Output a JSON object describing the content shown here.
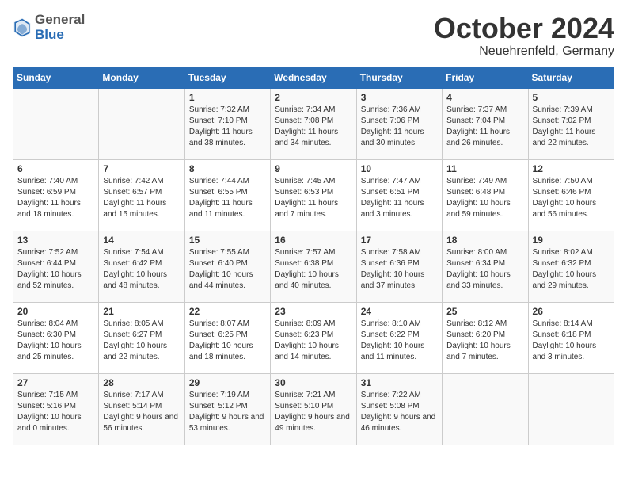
{
  "header": {
    "logo_general": "General",
    "logo_blue": "Blue",
    "month_title": "October 2024",
    "location": "Neuehrenfeld, Germany"
  },
  "days_of_week": [
    "Sunday",
    "Monday",
    "Tuesday",
    "Wednesday",
    "Thursday",
    "Friday",
    "Saturday"
  ],
  "weeks": [
    [
      {
        "day": "",
        "info": ""
      },
      {
        "day": "",
        "info": ""
      },
      {
        "day": "1",
        "info": "Sunrise: 7:32 AM\nSunset: 7:10 PM\nDaylight: 11 hours and 38 minutes."
      },
      {
        "day": "2",
        "info": "Sunrise: 7:34 AM\nSunset: 7:08 PM\nDaylight: 11 hours and 34 minutes."
      },
      {
        "day": "3",
        "info": "Sunrise: 7:36 AM\nSunset: 7:06 PM\nDaylight: 11 hours and 30 minutes."
      },
      {
        "day": "4",
        "info": "Sunrise: 7:37 AM\nSunset: 7:04 PM\nDaylight: 11 hours and 26 minutes."
      },
      {
        "day": "5",
        "info": "Sunrise: 7:39 AM\nSunset: 7:02 PM\nDaylight: 11 hours and 22 minutes."
      }
    ],
    [
      {
        "day": "6",
        "info": "Sunrise: 7:40 AM\nSunset: 6:59 PM\nDaylight: 11 hours and 18 minutes."
      },
      {
        "day": "7",
        "info": "Sunrise: 7:42 AM\nSunset: 6:57 PM\nDaylight: 11 hours and 15 minutes."
      },
      {
        "day": "8",
        "info": "Sunrise: 7:44 AM\nSunset: 6:55 PM\nDaylight: 11 hours and 11 minutes."
      },
      {
        "day": "9",
        "info": "Sunrise: 7:45 AM\nSunset: 6:53 PM\nDaylight: 11 hours and 7 minutes."
      },
      {
        "day": "10",
        "info": "Sunrise: 7:47 AM\nSunset: 6:51 PM\nDaylight: 11 hours and 3 minutes."
      },
      {
        "day": "11",
        "info": "Sunrise: 7:49 AM\nSunset: 6:48 PM\nDaylight: 10 hours and 59 minutes."
      },
      {
        "day": "12",
        "info": "Sunrise: 7:50 AM\nSunset: 6:46 PM\nDaylight: 10 hours and 56 minutes."
      }
    ],
    [
      {
        "day": "13",
        "info": "Sunrise: 7:52 AM\nSunset: 6:44 PM\nDaylight: 10 hours and 52 minutes."
      },
      {
        "day": "14",
        "info": "Sunrise: 7:54 AM\nSunset: 6:42 PM\nDaylight: 10 hours and 48 minutes."
      },
      {
        "day": "15",
        "info": "Sunrise: 7:55 AM\nSunset: 6:40 PM\nDaylight: 10 hours and 44 minutes."
      },
      {
        "day": "16",
        "info": "Sunrise: 7:57 AM\nSunset: 6:38 PM\nDaylight: 10 hours and 40 minutes."
      },
      {
        "day": "17",
        "info": "Sunrise: 7:58 AM\nSunset: 6:36 PM\nDaylight: 10 hours and 37 minutes."
      },
      {
        "day": "18",
        "info": "Sunrise: 8:00 AM\nSunset: 6:34 PM\nDaylight: 10 hours and 33 minutes."
      },
      {
        "day": "19",
        "info": "Sunrise: 8:02 AM\nSunset: 6:32 PM\nDaylight: 10 hours and 29 minutes."
      }
    ],
    [
      {
        "day": "20",
        "info": "Sunrise: 8:04 AM\nSunset: 6:30 PM\nDaylight: 10 hours and 25 minutes."
      },
      {
        "day": "21",
        "info": "Sunrise: 8:05 AM\nSunset: 6:27 PM\nDaylight: 10 hours and 22 minutes."
      },
      {
        "day": "22",
        "info": "Sunrise: 8:07 AM\nSunset: 6:25 PM\nDaylight: 10 hours and 18 minutes."
      },
      {
        "day": "23",
        "info": "Sunrise: 8:09 AM\nSunset: 6:23 PM\nDaylight: 10 hours and 14 minutes."
      },
      {
        "day": "24",
        "info": "Sunrise: 8:10 AM\nSunset: 6:22 PM\nDaylight: 10 hours and 11 minutes."
      },
      {
        "day": "25",
        "info": "Sunrise: 8:12 AM\nSunset: 6:20 PM\nDaylight: 10 hours and 7 minutes."
      },
      {
        "day": "26",
        "info": "Sunrise: 8:14 AM\nSunset: 6:18 PM\nDaylight: 10 hours and 3 minutes."
      }
    ],
    [
      {
        "day": "27",
        "info": "Sunrise: 7:15 AM\nSunset: 5:16 PM\nDaylight: 10 hours and 0 minutes."
      },
      {
        "day": "28",
        "info": "Sunrise: 7:17 AM\nSunset: 5:14 PM\nDaylight: 9 hours and 56 minutes."
      },
      {
        "day": "29",
        "info": "Sunrise: 7:19 AM\nSunset: 5:12 PM\nDaylight: 9 hours and 53 minutes."
      },
      {
        "day": "30",
        "info": "Sunrise: 7:21 AM\nSunset: 5:10 PM\nDaylight: 9 hours and 49 minutes."
      },
      {
        "day": "31",
        "info": "Sunrise: 7:22 AM\nSunset: 5:08 PM\nDaylight: 9 hours and 46 minutes."
      },
      {
        "day": "",
        "info": ""
      },
      {
        "day": "",
        "info": ""
      }
    ]
  ]
}
